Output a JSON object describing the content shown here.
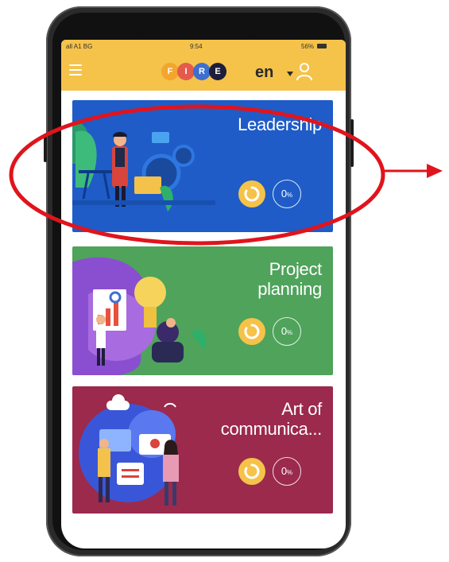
{
  "status_bar": {
    "carrier": "all A1 BG",
    "time": "9:54",
    "battery": "56%"
  },
  "app_bar": {
    "menu_icon": "hamburger-menu-icon",
    "logo_letters": [
      "F",
      "I",
      "R",
      "E"
    ],
    "language": "en",
    "user_icon": "user-icon"
  },
  "courses": [
    {
      "title": "Leadership",
      "progress": "0",
      "unit": "%",
      "color": "#1f5cc8"
    },
    {
      "title_line1": "Project",
      "title_line2": "planning",
      "progress": "0",
      "unit": "%",
      "color": "#4fa35b"
    },
    {
      "title_line1": "Art of",
      "title_line2": "communica...",
      "progress": "0",
      "unit": "%",
      "color": "#9b2a4c"
    }
  ],
  "annotation": {
    "highlight_color": "#e0141c"
  }
}
